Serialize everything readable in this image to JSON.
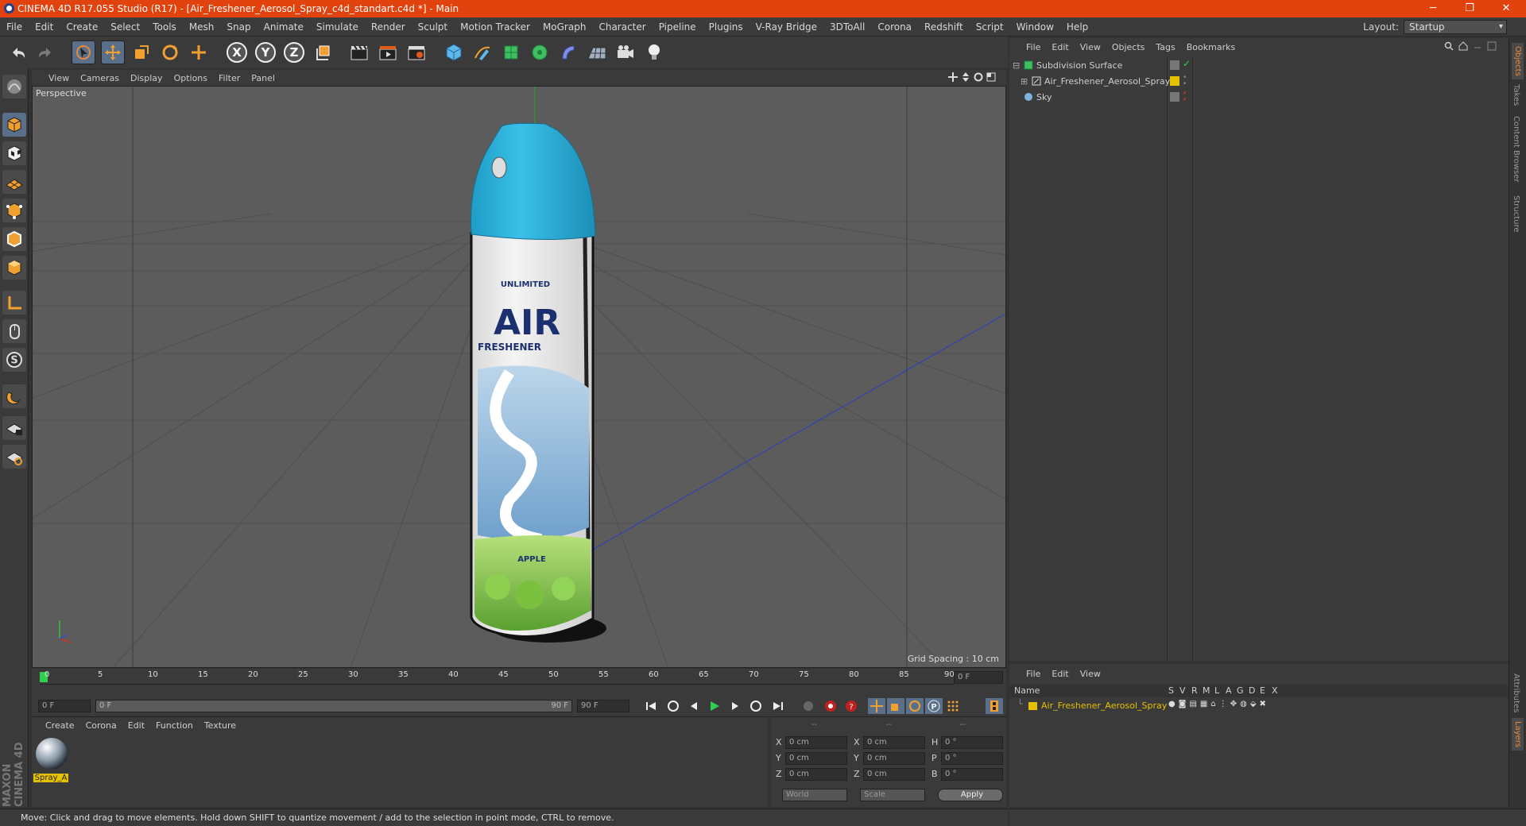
{
  "titlebar": {
    "title": "CINEMA 4D R17.055 Studio (R17) - [Air_Freshener_Aerosol_Spray_c4d_standart.c4d *] - Main",
    "minimize": "─",
    "restore": "❐",
    "close": "✕"
  },
  "menu": [
    "File",
    "Edit",
    "Create",
    "Select",
    "Tools",
    "Mesh",
    "Snap",
    "Animate",
    "Simulate",
    "Render",
    "Sculpt",
    "Motion Tracker",
    "MoGraph",
    "Character",
    "Pipeline",
    "Plugins",
    "V-Ray Bridge",
    "3DToAll",
    "Corona",
    "Redshift",
    "Script",
    "Window",
    "Help"
  ],
  "layout": {
    "label": "Layout:",
    "value": "Startup"
  },
  "toolbar": {
    "axis_x": "X",
    "axis_y": "Y",
    "axis_z": "Z"
  },
  "viewport": {
    "menu": [
      "View",
      "Cameras",
      "Display",
      "Options",
      "Filter",
      "Panel"
    ],
    "camera_label": "Perspective",
    "grid_spacing": "Grid Spacing : 10 cm",
    "product": {
      "title": "AIR",
      "subtitle": "FRESHENER",
      "brand": "UNLIMITED",
      "scent": "APPLE"
    }
  },
  "timeline": {
    "ticks": [
      "0",
      "5",
      "10",
      "15",
      "20",
      "25",
      "30",
      "35",
      "40",
      "45",
      "50",
      "55",
      "60",
      "65",
      "70",
      "75",
      "80",
      "85",
      "90"
    ],
    "current_frame": "0 F",
    "start": "0 F",
    "range_start": "0 F",
    "range_end": "90 F",
    "end": "90 F"
  },
  "material_panel": {
    "menu": [
      "Create",
      "Corona",
      "Edit",
      "Function",
      "Texture"
    ],
    "material_name": "Spray_A"
  },
  "coord_panel": {
    "header": [
      "--",
      "--",
      "--"
    ],
    "rows": [
      {
        "a": "X",
        "av": "0 cm",
        "b": "X",
        "bv": "0 cm",
        "c": "H",
        "cv": "0 °"
      },
      {
        "a": "Y",
        "av": "0 cm",
        "b": "Y",
        "bv": "0 cm",
        "c": "P",
        "cv": "0 °"
      },
      {
        "a": "Z",
        "av": "0 cm",
        "b": "Z",
        "bv": "0 cm",
        "c": "B",
        "cv": "0 °"
      }
    ],
    "mode": "World",
    "scale": "Scale",
    "apply": "Apply"
  },
  "object_manager": {
    "menu": [
      "File",
      "Edit",
      "View",
      "Objects",
      "Tags",
      "Bookmarks"
    ],
    "objects": [
      {
        "name": "Subdivision Surface"
      },
      {
        "name": "Air_Freshener_Aerosol_Spray"
      },
      {
        "name": "Sky"
      }
    ]
  },
  "layer_manager": {
    "menu": [
      "File",
      "Edit",
      "View"
    ],
    "columns": {
      "name": "Name",
      "flags": [
        "S",
        "V",
        "R",
        "M",
        "L",
        "A",
        "G",
        "D",
        "E",
        "X"
      ]
    },
    "layers": [
      {
        "name": "Air_Freshener_Aerosol_Spray",
        "color": "#e5c100"
      }
    ]
  },
  "side_tabs": [
    "Objects",
    "Takes",
    "Content Browser",
    "Structure"
  ],
  "side_tabs_bottom": [
    "Attributes",
    "Layers"
  ],
  "brand_vertical": "MAXON CINEMA 4D",
  "status": "Move: Click and drag to move elements. Hold down SHIFT to quantize movement / add to the selection in point mode, CTRL to remove.",
  "colors": {
    "accent": "#e2430e",
    "cap": "#2fb2d8",
    "select": "#5a6f8a",
    "layer": "#e5c100"
  }
}
